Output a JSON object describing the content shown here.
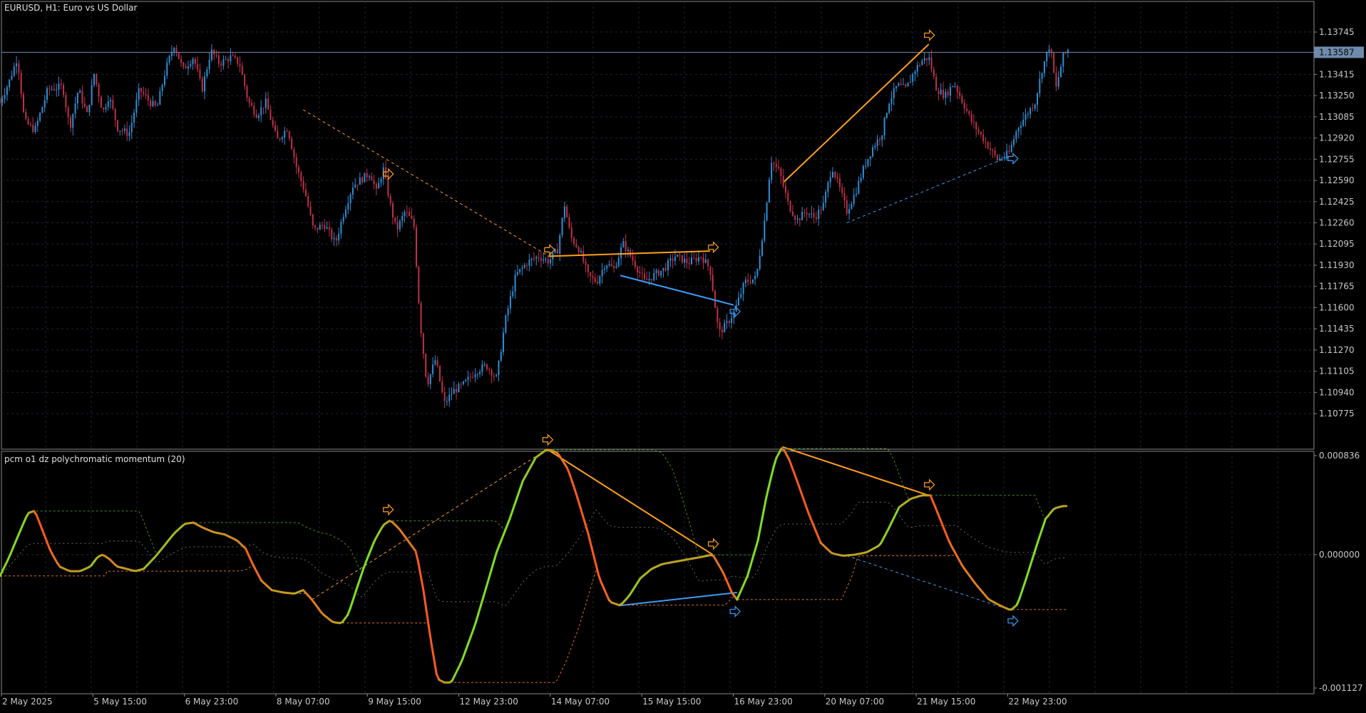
{
  "chart_data": [
    {
      "type": "candlestick",
      "title": "EURUSD, H1:  Euro vs US Dollar",
      "symbol": "EURUSD",
      "timeframe": "H1",
      "description": "Euro vs US Dollar",
      "ylim": [
        1.1067,
        1.1385
      ],
      "yticks": [
        "1.13745",
        "1.13415",
        "1.13250",
        "1.13085",
        "1.12920",
        "1.12755",
        "1.12590",
        "1.12425",
        "1.12260",
        "1.12095",
        "1.11930",
        "1.11765",
        "1.11600",
        "1.11435",
        "1.11270",
        "1.11105",
        "1.10940",
        "1.10775"
      ],
      "current_price_label": "1.13587",
      "current_price": 1.13587,
      "grid": true,
      "colors": {
        "bull": "#2f8fd6",
        "bear": "#c0314a",
        "bullish_divergence": "#3d9cf5",
        "bearish_divergence": "#ff9f1c",
        "price_line": "#6f8bab"
      },
      "close_path": [
        [
          0,
          1.132
        ],
        [
          10,
          1.1335
        ],
        [
          20,
          1.1355
        ],
        [
          28,
          1.1305
        ],
        [
          40,
          1.1298
        ],
        [
          55,
          1.133
        ],
        [
          72,
          1.1332
        ],
        [
          80,
          1.13
        ],
        [
          90,
          1.133
        ],
        [
          100,
          1.131
        ],
        [
          108,
          1.1342
        ],
        [
          118,
          1.1312
        ],
        [
          125,
          1.1325
        ],
        [
          135,
          1.13
        ],
        [
          148,
          1.1295
        ],
        [
          160,
          1.133
        ],
        [
          172,
          1.132
        ],
        [
          180,
          1.1315
        ],
        [
          190,
          1.1345
        ],
        [
          200,
          1.1365
        ],
        [
          210,
          1.1345
        ],
        [
          222,
          1.1355
        ],
        [
          232,
          1.133
        ],
        [
          242,
          1.136
        ],
        [
          252,
          1.135
        ],
        [
          265,
          1.1355
        ],
        [
          275,
          1.135
        ],
        [
          285,
          1.132
        ],
        [
          295,
          1.131
        ],
        [
          305,
          1.132
        ],
        [
          318,
          1.129
        ],
        [
          330,
          1.13
        ],
        [
          340,
          1.127
        ],
        [
          350,
          1.125
        ],
        [
          360,
          1.122
        ],
        [
          372,
          1.1225
        ],
        [
          385,
          1.121
        ],
        [
          395,
          1.1235
        ],
        [
          405,
          1.1255
        ],
        [
          415,
          1.126
        ],
        [
          425,
          1.1265
        ],
        [
          432,
          1.125
        ],
        [
          440,
          1.1268
        ],
        [
          448,
          1.124
        ],
        [
          455,
          1.122
        ],
        [
          465,
          1.1235
        ],
        [
          475,
          1.1225
        ],
        [
          482,
          1.115
        ],
        [
          490,
          1.11
        ],
        [
          500,
          1.112
        ],
        [
          510,
          1.1085
        ],
        [
          520,
          1.1095
        ],
        [
          532,
          1.11
        ],
        [
          545,
          1.111
        ],
        [
          558,
          1.1115
        ],
        [
          570,
          1.1105
        ],
        [
          580,
          1.115
        ],
        [
          592,
          1.1185
        ],
        [
          605,
          1.1195
        ],
        [
          618,
          1.12
        ],
        [
          630,
          1.1196
        ],
        [
          640,
          1.1205
        ],
        [
          648,
          1.124
        ],
        [
          655,
          1.1215
        ],
        [
          665,
          1.1205
        ],
        [
          675,
          1.1185
        ],
        [
          685,
          1.118
        ],
        [
          695,
          1.1195
        ],
        [
          705,
          1.119
        ],
        [
          715,
          1.121
        ],
        [
          728,
          1.1195
        ],
        [
          740,
          1.118
        ],
        [
          750,
          1.1185
        ],
        [
          762,
          1.119
        ],
        [
          775,
          1.12
        ],
        [
          790,
          1.1195
        ],
        [
          805,
          1.12
        ],
        [
          815,
          1.119
        ],
        [
          825,
          1.114
        ],
        [
          835,
          1.1148
        ],
        [
          843,
          1.1157
        ],
        [
          855,
          1.118
        ],
        [
          868,
          1.1183
        ],
        [
          878,
          1.123
        ],
        [
          885,
          1.1275
        ],
        [
          895,
          1.1265
        ],
        [
          905,
          1.124
        ],
        [
          915,
          1.1228
        ],
        [
          925,
          1.1235
        ],
        [
          935,
          1.123
        ],
        [
          945,
          1.124
        ],
        [
          955,
          1.127
        ],
        [
          965,
          1.125
        ],
        [
          972,
          1.1235
        ],
        [
          982,
          1.125
        ],
        [
          992,
          1.127
        ],
        [
          1002,
          1.1285
        ],
        [
          1012,
          1.1295
        ],
        [
          1020,
          1.132
        ],
        [
          1030,
          1.1333
        ],
        [
          1040,
          1.133
        ],
        [
          1050,
          1.1345
        ],
        [
          1058,
          1.1352
        ],
        [
          1066,
          1.1355
        ],
        [
          1075,
          1.133
        ],
        [
          1085,
          1.1325
        ],
        [
          1095,
          1.1335
        ],
        [
          1105,
          1.132
        ],
        [
          1115,
          1.1305
        ],
        [
          1125,
          1.1295
        ],
        [
          1135,
          1.1285
        ],
        [
          1145,
          1.1275
        ],
        [
          1158,
          1.128
        ],
        [
          1168,
          1.13
        ],
        [
          1178,
          1.131
        ],
        [
          1188,
          1.132
        ],
        [
          1196,
          1.1345
        ],
        [
          1205,
          1.1365
        ],
        [
          1212,
          1.133
        ],
        [
          1220,
          1.1355
        ],
        [
          1227,
          1.1362
        ]
      ],
      "divergence_lines": [
        {
          "kind": "bearish",
          "style": "dashed",
          "from": [
            348,
            1.1314
          ],
          "to": [
            630,
            1.12
          ]
        },
        {
          "kind": "bearish",
          "style": "solid",
          "from": [
            630,
            1.12
          ],
          "to": [
            815,
            1.1204
          ]
        },
        {
          "kind": "bullish",
          "style": "solid",
          "from": [
            712,
            1.1185
          ],
          "to": [
            842,
            1.1162
          ]
        },
        {
          "kind": "bearish",
          "style": "solid",
          "from": [
            900,
            1.1258
          ],
          "to": [
            1066,
            1.1365
          ]
        },
        {
          "kind": "bullish",
          "style": "dashed",
          "from": [
            972,
            1.1226
          ],
          "to": [
            1160,
            1.1278
          ]
        }
      ],
      "signal_arrows": [
        {
          "kind": "bearish",
          "at": [
            445,
            1.1264
          ]
        },
        {
          "kind": "bearish",
          "at": [
            630,
            1.1205
          ]
        },
        {
          "kind": "bearish",
          "at": [
            818,
            1.1207
          ]
        },
        {
          "kind": "bullish",
          "at": [
            843,
            1.1157
          ]
        },
        {
          "kind": "bearish",
          "at": [
            1066,
            1.1372
          ]
        },
        {
          "kind": "bullish",
          "at": [
            1162,
            1.1276
          ]
        }
      ]
    },
    {
      "type": "line",
      "title": "pcm o1 dz polychromatic momentum (20)",
      "ylim": [
        -0.001127,
        0.000836
      ],
      "yticks": [
        "0.000836",
        "0.000000",
        "-0.001127"
      ],
      "colors": {
        "rising": "#7ee023",
        "falling": "#ff5a1e",
        "upper_zone": "#3c8c1e",
        "lower_zone": "#e0701a",
        "mid_line": "#6a6a6a"
      },
      "momentum": [
        [
          0,
          -0.00018
        ],
        [
          10,
          -3e-05
        ],
        [
          22,
          0.00018
        ],
        [
          32,
          0.00035
        ],
        [
          40,
          0.00037
        ],
        [
          48,
          0.00022
        ],
        [
          58,
          3e-05
        ],
        [
          68,
          -0.0001
        ],
        [
          80,
          -0.00014
        ],
        [
          92,
          -0.00014
        ],
        [
          104,
          -0.0001
        ],
        [
          112,
          -2e-05
        ],
        [
          118,
          0.0
        ],
        [
          126,
          -4e-05
        ],
        [
          134,
          -0.0001
        ],
        [
          145,
          -0.00012
        ],
        [
          155,
          -0.00014
        ],
        [
          165,
          -0.00012
        ],
        [
          178,
          -2e-05
        ],
        [
          188,
          7e-05
        ],
        [
          200,
          0.00018
        ],
        [
          212,
          0.00026
        ],
        [
          222,
          0.00027
        ],
        [
          232,
          0.00023
        ],
        [
          245,
          0.00019
        ],
        [
          258,
          0.00017
        ],
        [
          272,
          0.00012
        ],
        [
          282,
          5e-05
        ],
        [
          290,
          -8e-05
        ],
        [
          300,
          -0.00022
        ],
        [
          312,
          -0.0003
        ],
        [
          325,
          -0.00032
        ],
        [
          338,
          -0.00033
        ],
        [
          348,
          -0.0003
        ],
        [
          358,
          -0.00038
        ],
        [
          370,
          -0.0005
        ],
        [
          382,
          -0.00057
        ],
        [
          392,
          -0.00058
        ],
        [
          400,
          -0.0005
        ],
        [
          408,
          -0.00032
        ],
        [
          418,
          -0.0001
        ],
        [
          430,
          0.00012
        ],
        [
          440,
          0.00025
        ],
        [
          448,
          0.00029
        ],
        [
          458,
          0.00022
        ],
        [
          468,
          0.00012
        ],
        [
          478,
          2e-05
        ],
        [
          486,
          -0.0003
        ],
        [
          494,
          -0.0007
        ],
        [
          502,
          -0.00105
        ],
        [
          510,
          -0.00108
        ],
        [
          518,
          -0.00108
        ],
        [
          530,
          -0.0009
        ],
        [
          545,
          -0.0006
        ],
        [
          558,
          -0.00028
        ],
        [
          570,
          2e-05
        ],
        [
          585,
          0.0003
        ],
        [
          600,
          0.00062
        ],
        [
          615,
          0.00082
        ],
        [
          628,
          0.00089
        ],
        [
          640,
          0.00086
        ],
        [
          652,
          0.00072
        ],
        [
          662,
          0.0005
        ],
        [
          675,
          0.00018
        ],
        [
          688,
          -0.0002
        ],
        [
          700,
          -0.0004
        ],
        [
          712,
          -0.00043
        ],
        [
          722,
          -0.00035
        ],
        [
          735,
          -0.0002
        ],
        [
          748,
          -0.00012
        ],
        [
          760,
          -8e-05
        ],
        [
          775,
          -6e-05
        ],
        [
          790,
          -4e-05
        ],
        [
          805,
          -2e-05
        ],
        [
          818,
          0.0
        ],
        [
          830,
          -0.00015
        ],
        [
          840,
          -0.00032
        ],
        [
          846,
          -0.00038
        ],
        [
          858,
          -0.00018
        ],
        [
          870,
          0.00012
        ],
        [
          880,
          0.0005
        ],
        [
          890,
          0.0008
        ],
        [
          898,
          0.00091
        ],
        [
          906,
          0.0008
        ],
        [
          916,
          0.0006
        ],
        [
          928,
          0.00035
        ],
        [
          942,
          0.0001
        ],
        [
          955,
          1e-05
        ],
        [
          968,
          -1e-05
        ],
        [
          982,
          0.0
        ],
        [
          995,
          2e-05
        ],
        [
          1010,
          8e-05
        ],
        [
          1020,
          0.00022
        ],
        [
          1032,
          0.0004
        ],
        [
          1045,
          0.00047
        ],
        [
          1058,
          0.0005
        ],
        [
          1068,
          0.0005
        ],
        [
          1078,
          0.00032
        ],
        [
          1090,
          0.0001
        ],
        [
          1105,
          -0.0001
        ],
        [
          1120,
          -0.00025
        ],
        [
          1135,
          -0.00038
        ],
        [
          1148,
          -0.00043
        ],
        [
          1160,
          -0.00047
        ],
        [
          1168,
          -0.00042
        ],
        [
          1178,
          -0.0002
        ],
        [
          1190,
          8e-05
        ],
        [
          1200,
          0.0003
        ],
        [
          1210,
          0.00039
        ],
        [
          1220,
          0.00041
        ],
        [
          1226,
          0.00041
        ]
      ],
      "divergence_lines": [
        {
          "kind": "bearish",
          "style": "dashed",
          "from": [
            358,
            -0.00038
          ],
          "to": [
            628,
            0.00089
          ]
        },
        {
          "kind": "bearish",
          "style": "solid",
          "from": [
            628,
            0.00089
          ],
          "to": [
            818,
            0.0
          ]
        },
        {
          "kind": "bullish",
          "style": "solid",
          "from": [
            712,
            -0.00043
          ],
          "to": [
            846,
            -0.00032
          ]
        },
        {
          "kind": "bearish",
          "style": "solid",
          "from": [
            898,
            0.00091
          ],
          "to": [
            1066,
            0.0005
          ]
        },
        {
          "kind": "bullish",
          "style": "dashed",
          "from": [
            972,
            -1e-05
          ],
          "to": [
            1160,
            -0.00047
          ]
        }
      ],
      "signal_arrows": [
        {
          "kind": "bearish",
          "at": [
            445,
            0.00038
          ]
        },
        {
          "kind": "bearish",
          "at": [
            628,
            0.00097
          ]
        },
        {
          "kind": "bearish",
          "at": [
            818,
            9e-05
          ]
        },
        {
          "kind": "bullish",
          "at": [
            843,
            -0.00048
          ]
        },
        {
          "kind": "bearish",
          "at": [
            1066,
            0.00059
          ]
        },
        {
          "kind": "bullish",
          "at": [
            1162,
            -0.00056
          ]
        }
      ]
    }
  ],
  "x_axis": {
    "labels": [
      {
        "x": 0,
        "text": "2 May 2025"
      },
      {
        "x": 105,
        "text": "5 May 15:00"
      },
      {
        "x": 210,
        "text": "6 May 23:00"
      },
      {
        "x": 315,
        "text": "8 May 07:00"
      },
      {
        "x": 420,
        "text": "9 May 15:00"
      },
      {
        "x": 525,
        "text": "12 May 23:00"
      },
      {
        "x": 630,
        "text": "14 May 07:00"
      },
      {
        "x": 735,
        "text": "15 May 15:00"
      },
      {
        "x": 840,
        "text": "16 May 23:00"
      },
      {
        "x": 945,
        "text": "20 May 07:00"
      },
      {
        "x": 1050,
        "text": "21 May 15:00"
      },
      {
        "x": 1155,
        "text": "22 May 23:00"
      }
    ]
  }
}
